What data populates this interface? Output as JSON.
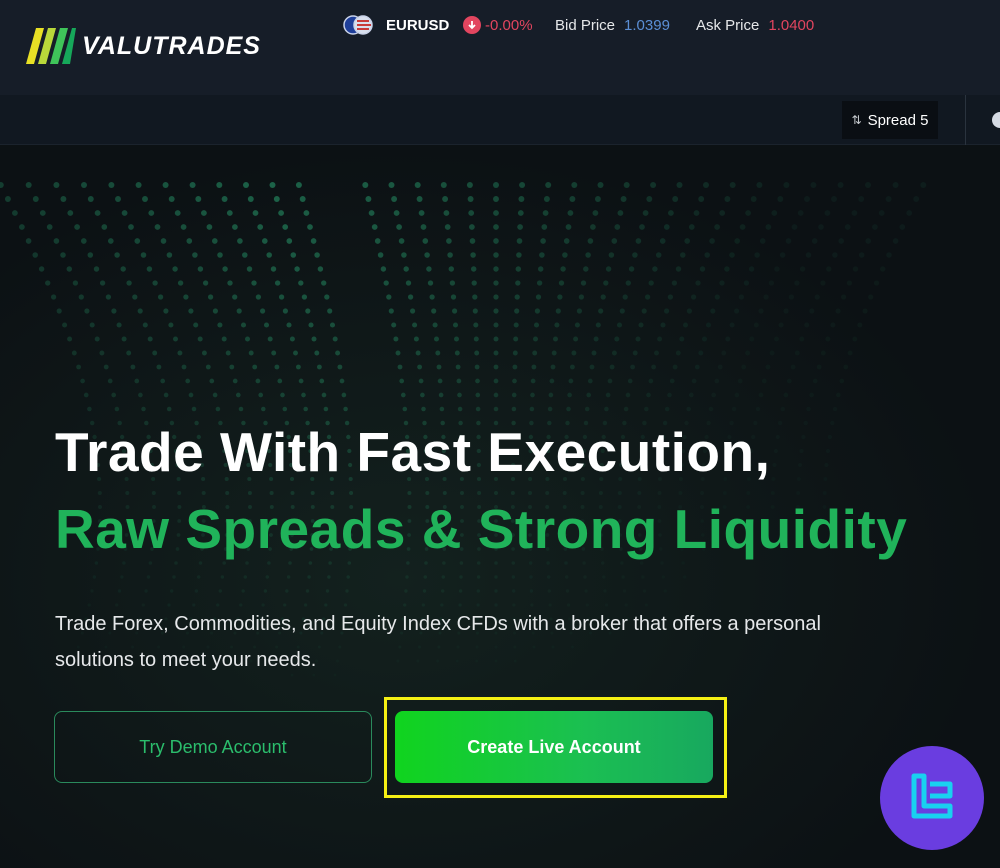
{
  "header": {
    "brand": "VALUTRADES"
  },
  "ticker": {
    "symbol": "EURUSD",
    "change": "-0.00%",
    "bid_label": "Bid Price",
    "bid_value": "1.0399",
    "ask_label": "Ask Price",
    "ask_value": "1.0400",
    "spread_label": "Spread 5"
  },
  "hero": {
    "headline_line1": "Trade With Fast Execution,",
    "headline_line2": "Raw Spreads & Strong Liquidity",
    "subtext_line1": "Trade Forex, Commodities, and Equity Index CFDs with a broker that offers a personal",
    "subtext_line2": "solutions to meet your needs.",
    "demo_button": "Try Demo Account",
    "live_button": "Create Live Account"
  },
  "colors": {
    "accent_green": "#20b35a",
    "price_down": "#e2455f",
    "bid_blue": "#5b8fd6",
    "highlight_yellow": "#f5f014",
    "badge_purple": "#6a3de0"
  },
  "icons": [
    "valutrades-logo-icon",
    "eu-us-flag-icon",
    "arrow-down-icon",
    "sort-arrows-icon",
    "tradingfinder-badge-icon"
  ]
}
